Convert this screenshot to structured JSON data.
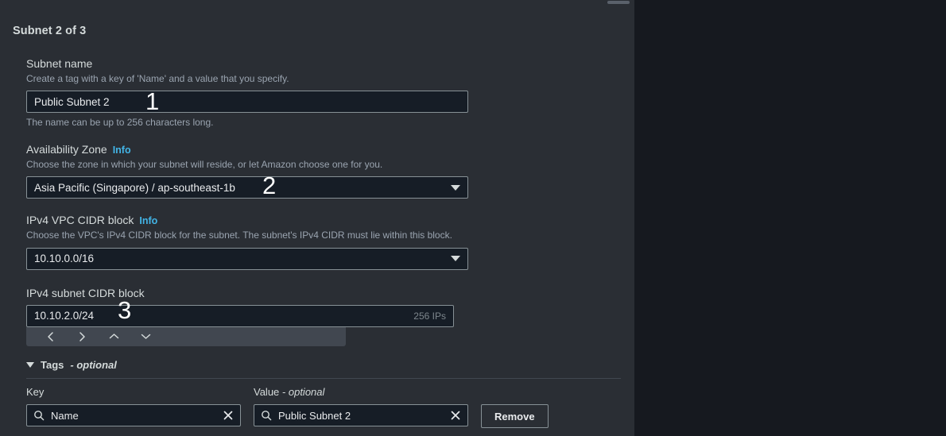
{
  "section": {
    "title": "Subnet 2 of 3"
  },
  "fields": {
    "subnet_name": {
      "label": "Subnet name",
      "description": "Create a tag with a key of 'Name' and a value that you specify.",
      "value": "Public Subnet 2",
      "hint": "The name can be up to 256 characters long."
    },
    "availability_zone": {
      "label": "Availability Zone",
      "info": "Info",
      "description": "Choose the zone in which your subnet will reside, or let Amazon choose one for you.",
      "value": "Asia Pacific (Singapore) / ap-southeast-1b"
    },
    "vpc_cidr": {
      "label": "IPv4 VPC CIDR block",
      "info": "Info",
      "description": "Choose the VPC's IPv4 CIDR block for the subnet. The subnet's IPv4 CIDR must lie within this block.",
      "value": "10.10.0.0/16"
    },
    "subnet_cidr": {
      "label": "IPv4 subnet CIDR block",
      "value": "10.10.2.0/24",
      "suffix": "256 IPs"
    }
  },
  "stepper": {
    "prev": "chevron-left",
    "next": "chevron-right",
    "up": "chevron-up",
    "down": "chevron-down"
  },
  "tags": {
    "header": "Tags",
    "header_optional": "- optional",
    "key_label": "Key",
    "value_label": "Value",
    "value_label_optional": "- optional",
    "key_value": "Name",
    "value_value": "Public Subnet 2",
    "remove_label": "Remove"
  },
  "markers": {
    "one": "1",
    "two": "2",
    "three": "3"
  },
  "colors": {
    "panel_left": "#2a2e34",
    "panel_right": "#16191f",
    "input_bg": "#161d26",
    "border": "#879196",
    "accent_link": "#42b4e6",
    "text_primary": "#d5dbdb",
    "text_muted": "#9aa4b0",
    "stepper_bg": "#414750"
  }
}
